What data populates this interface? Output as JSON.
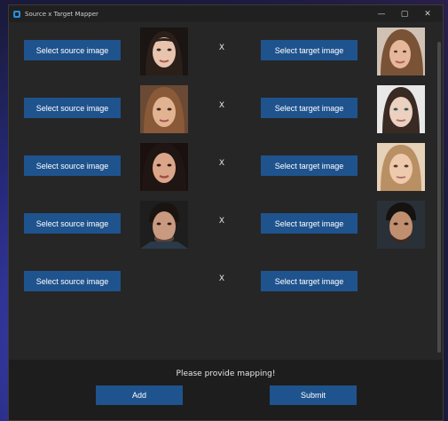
{
  "window": {
    "title": "Source x Target Mapper",
    "minimize_glyph": "—",
    "maximize_glyph": "▢",
    "close_glyph": "✕"
  },
  "mappings": [
    {
      "source_button": "Select source image",
      "separator": "X",
      "target_button": "Select target image",
      "source_thumb": "face-1",
      "target_thumb": "face-2"
    },
    {
      "source_button": "Select source image",
      "separator": "X",
      "target_button": "Select target image",
      "source_thumb": "face-3",
      "target_thumb": "face-4"
    },
    {
      "source_button": "Select source image",
      "separator": "X",
      "target_button": "Select target image",
      "source_thumb": "face-5",
      "target_thumb": "face-6"
    },
    {
      "source_button": "Select source image",
      "separator": "X",
      "target_button": "Select target image",
      "source_thumb": "face-7",
      "target_thumb": "face-8"
    },
    {
      "source_button": "Select source image",
      "separator": "X",
      "target_button": "Select target image",
      "source_thumb": null,
      "target_thumb": null
    }
  ],
  "footer": {
    "status": "Please provide mapping!",
    "add_button": "Add",
    "submit_button": "Submit"
  },
  "colors": {
    "button_bg": "#1f538d",
    "window_bg": "#262626",
    "footer_bg": "#1d1d1d"
  }
}
